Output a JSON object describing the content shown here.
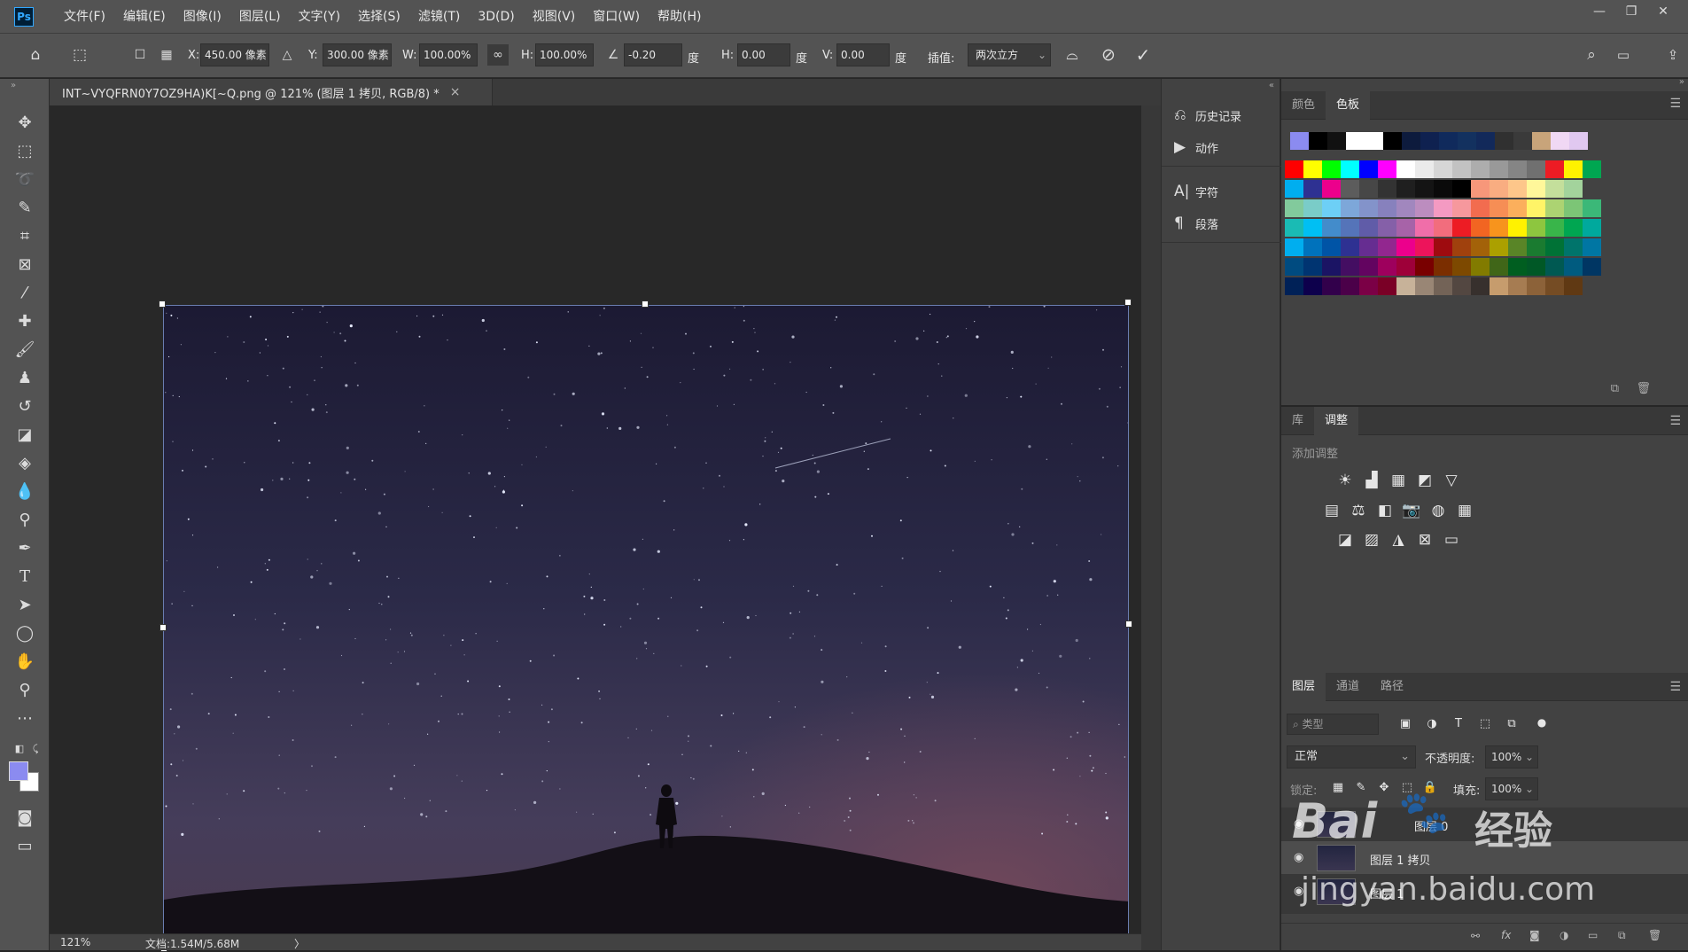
{
  "app": {
    "logo": "Ps",
    "menus": [
      "文件(F)",
      "编辑(E)",
      "图像(I)",
      "图层(L)",
      "文字(Y)",
      "选择(S)",
      "滤镜(T)",
      "3D(D)",
      "视图(V)",
      "窗口(W)",
      "帮助(H)"
    ],
    "window_controls": [
      "—",
      "❐",
      "✕"
    ]
  },
  "options": {
    "x_label": "X:",
    "x_value": "450.00 像素",
    "y_label": "Y:",
    "y_value": "300.00 像素",
    "w_label": "W:",
    "w_value": "100.00%",
    "h_label": "H:",
    "h_value": "100.00%",
    "angle_value": "-0.20",
    "angle_unit": "度",
    "hskew_label": "H:",
    "hskew_value": "0.00",
    "hskew_unit": "度",
    "vskew_label": "V:",
    "vskew_value": "0.00",
    "vskew_unit": "度",
    "interp_label": "插值:",
    "interp_value": "两次立方"
  },
  "document": {
    "tab_title": "INT~VYQFRN0Y7OZ9HA)K[~Q.png @ 121% (图层 1 拷贝, RGB/8) *",
    "close": "×",
    "zoom": "121%",
    "doc_info": "文档:1.54M/5.68M",
    "status_arrow": "〉"
  },
  "mid_panel": {
    "items": [
      {
        "icon": "history-icon",
        "label": "历史记录"
      },
      {
        "icon": "play-icon",
        "label": "动作"
      },
      {
        "icon": "character-icon",
        "label": "字符"
      },
      {
        "icon": "paragraph-icon",
        "label": "段落"
      }
    ]
  },
  "swatches_panel": {
    "tabs": [
      "颜色",
      "色板"
    ],
    "active_tab": "色板"
  },
  "adjustments_panel": {
    "tabs": [
      "库",
      "调整"
    ],
    "active_tab": "调整",
    "hint": "添加调整"
  },
  "layers_panel": {
    "tabs": [
      "图层",
      "通道",
      "路径"
    ],
    "active_tab": "图层",
    "filter_placeholder": "类型",
    "blend_mode": "正常",
    "opacity_label": "不透明度:",
    "opacity_value": "100%",
    "lock_label": "锁定:",
    "fill_label": "填充:",
    "fill_value": "100%",
    "layers": [
      {
        "name": "图层 0",
        "selected": false
      },
      {
        "name": "图层 1 拷贝",
        "selected": true
      },
      {
        "name": "图层 1",
        "selected": false
      }
    ]
  },
  "watermark": {
    "logo_text": "Bai",
    "brand": "经验",
    "url": "jingyan.baidu.com"
  }
}
